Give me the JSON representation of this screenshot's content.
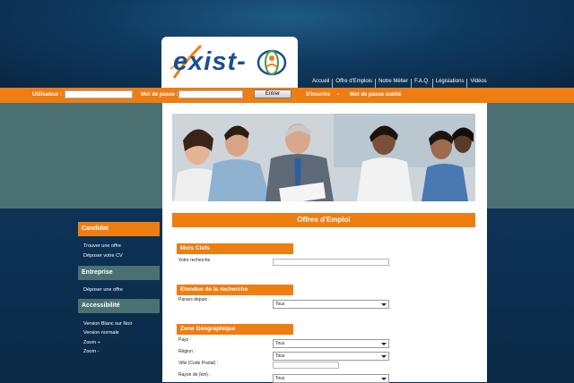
{
  "brand": {
    "logo_text": "exist-"
  },
  "topnav": [
    "Accueil",
    "Offre d'Emplois",
    "Notre Métier",
    "F.A.Q.",
    "Législations",
    "Vidéos"
  ],
  "login": {
    "user_label": "Utilisateur :",
    "password_label": "Mot de passe :",
    "submit_label": "Entrer",
    "register_link": "S'inscrire",
    "separator": "-",
    "forgot_link": "Mot de passe oublié"
  },
  "main": {
    "title": "Offres d'Emploi",
    "keywords": {
      "heading": "Mots Clefs",
      "search_label": "Votre recherche",
      "search_value": ""
    },
    "range": {
      "heading": "Etendue de la recherche",
      "posted_label": "Parues depuis :",
      "posted_value": "Tous"
    },
    "geo": {
      "heading": "Zone Géographique",
      "country_label": "Pays :",
      "country_value": "Tous",
      "region_label": "Région :",
      "region_value": "Tous",
      "city_label": "Ville (Code Postal) :",
      "city_value": "",
      "radius_label": "Rayon de (km) :",
      "radius_value": "Tous"
    }
  },
  "sidebar": {
    "candidat": {
      "title": "Candidat",
      "links": [
        "Trouver une offre",
        "Déposer votre CV"
      ]
    },
    "entreprise": {
      "title": "Entreprise",
      "links": [
        "Déposer une offre"
      ]
    },
    "accessibilite": {
      "title": "Accessibilité",
      "links": [
        "Version Blanc sur Noir",
        "Version normale",
        "Zoom +",
        "Zoom -"
      ]
    }
  },
  "colors": {
    "accent": "#ee7d12",
    "band": "#4b7072",
    "navy": "#0b2c49"
  }
}
